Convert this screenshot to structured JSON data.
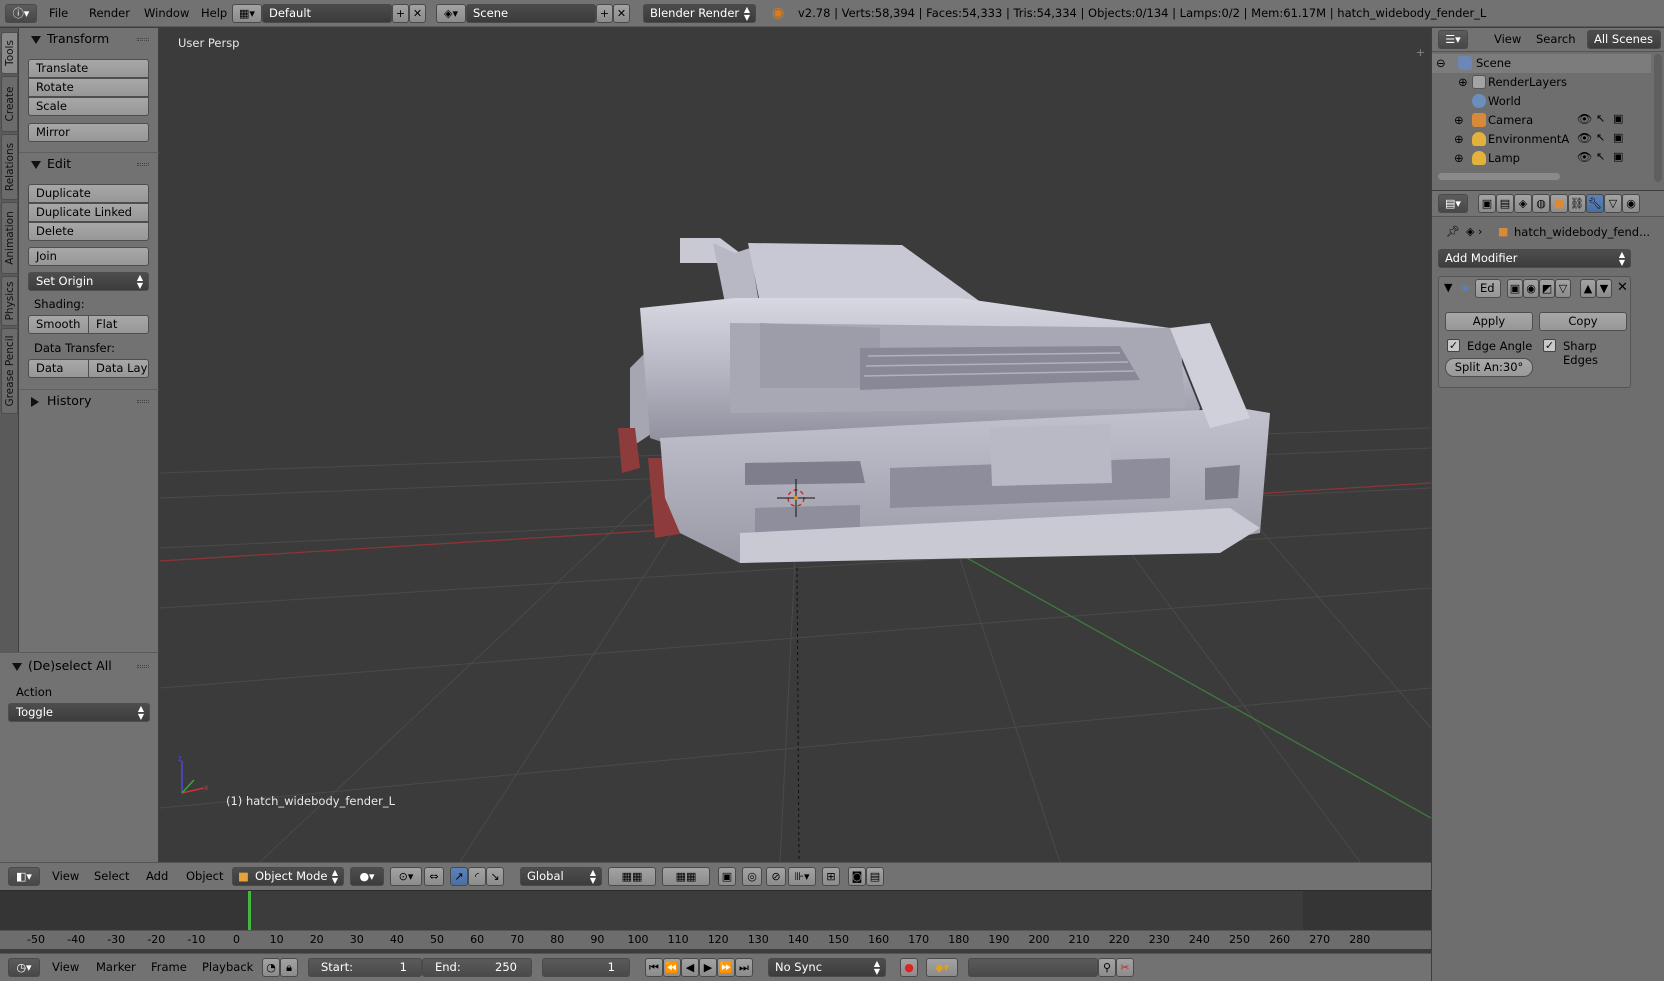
{
  "topbar": {
    "menu": [
      "File",
      "Render",
      "Window",
      "Help"
    ],
    "layout": "Default",
    "scene": "Scene",
    "engine": "Blender Render",
    "status": "v2.78 | Verts:58,394 | Faces:54,333 | Tris:54,334 | Objects:0/134 | Lamps:0/2 | Mem:61.17M | hatch_widebody_fender_L"
  },
  "tabs": [
    "Tools",
    "Create",
    "Relations",
    "Animation",
    "Physics",
    "Grease Pencil"
  ],
  "tools": {
    "transform": {
      "title": "Transform",
      "items": [
        "Translate",
        "Rotate",
        "Scale"
      ],
      "mirror": "Mirror"
    },
    "edit": {
      "title": "Edit",
      "items": [
        "Duplicate",
        "Duplicate Linked",
        "Delete"
      ],
      "join": "Join",
      "origin": "Set Origin"
    },
    "shading": {
      "label": "Shading:",
      "smooth": "Smooth",
      "flat": "Flat"
    },
    "transfer": {
      "label": "Data Transfer:",
      "data": "Data",
      "layout": "Data Layo"
    },
    "history": "History"
  },
  "operator": {
    "title": "(De)select All",
    "action_label": "Action",
    "action_value": "Toggle"
  },
  "viewport": {
    "view_name": "User Persp",
    "object_label": "(1) hatch_widebody_fender_L"
  },
  "v3d_header": {
    "menu": [
      "View",
      "Select",
      "Add",
      "Object"
    ],
    "mode": "Object Mode",
    "orientation": "Global"
  },
  "timeline": {
    "ticks": [
      "-50",
      "-40",
      "-30",
      "-20",
      "-10",
      "0",
      "10",
      "20",
      "30",
      "40",
      "50",
      "60",
      "70",
      "80",
      "90",
      "100",
      "110",
      "120",
      "130",
      "140",
      "150",
      "160",
      "170",
      "180",
      "190",
      "200",
      "210",
      "220",
      "230",
      "240",
      "250",
      "260",
      "270",
      "280"
    ],
    "menu": [
      "View",
      "Marker",
      "Frame",
      "Playback"
    ],
    "start_label": "Start:",
    "start": "1",
    "end_label": "End:",
    "end": "250",
    "current": "1",
    "sync": "No Sync"
  },
  "outliner": {
    "menu": [
      "View",
      "Search",
      "All Scenes"
    ],
    "rows": [
      "Scene",
      "RenderLayers",
      "World",
      "Camera",
      "EnvironmentAml",
      "Lamp"
    ]
  },
  "properties": {
    "object_name": "hatch_widebody_fend...",
    "add_modifier": "Add Modifier",
    "modifier_short": "Ed",
    "apply": "Apply",
    "copy": "Copy",
    "edge_angle": "Edge Angle",
    "sharp_edges": "Sharp Edges",
    "split_angle": "Split An:30°"
  }
}
